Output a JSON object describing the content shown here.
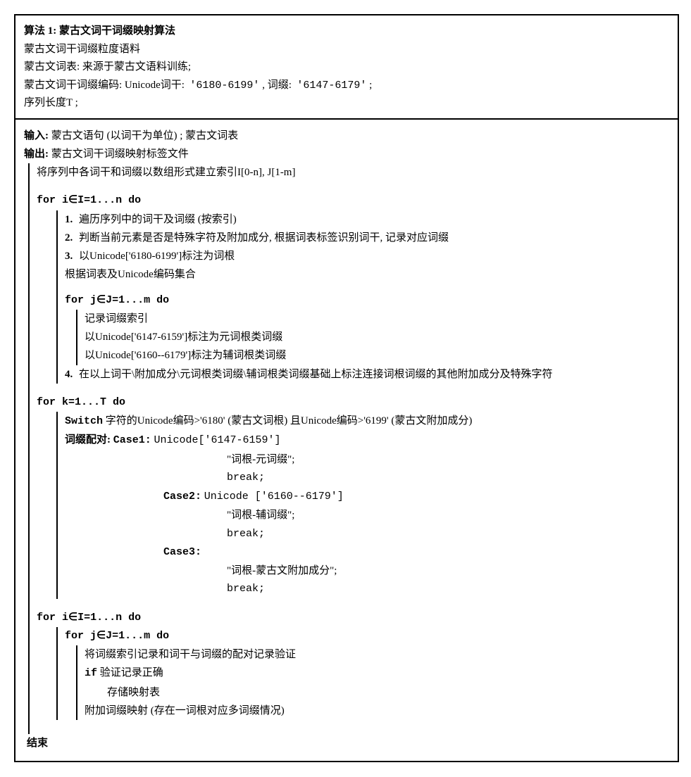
{
  "header": {
    "title_label": "算法 1:",
    "title_text": "蒙古文词干词缀映射算法",
    "line2": "蒙古文词干词缀粒度语料",
    "line3": "蒙古文词表: 来源于蒙古文语料训练;",
    "line4_prefix": "蒙古文词干词缀编码: Unicode词干:",
    "line4_stem_range": "'6180-6199'",
    "line4_mid": ", 词缀:",
    "line4_suffix_range": "'6147-6179'",
    "line4_end": ";",
    "line5": "序列长度T ;"
  },
  "io": {
    "input_label": "输入:",
    "input_text": "蒙古文语句 (以词干为单位) ; 蒙古文词表",
    "output_label": "输出:",
    "output_text": "蒙古文词干词缀映射标签文件",
    "index_line": "将序列中各词干和词缀以数组形式建立索引I[0-n], J[1-m]"
  },
  "loop1": {
    "for_head": "for i∈I=1...n do",
    "step1": "遍历序列中的词干及词缀 (按索引)",
    "step2": "判断当前元素是否是特殊字符及附加成分, 根据词表标签识别词干, 记录对应词缀",
    "step3": "以Unicode['6180-6199']标注为词根",
    "step3b": "根据词表及Unicode编码集合",
    "inner_for": "for j∈J=1...m do",
    "inner1": "记录词缀索引",
    "inner2": "以Unicode['6147-6159']标注为元词根类词缀",
    "inner3": "以Unicode['6160--6179']标注为辅词根类词缀",
    "step4": "在以上词干\\附加成分\\元词根类词缀\\辅词根类词缀基础上标注连接词根词缀的其他附加成分及特殊字符"
  },
  "loop2": {
    "for_head": "for k=1...T do",
    "switch_label": "Switch",
    "switch_cond": "字符的Unicode编码>'6180' (蒙古文词根) 且Unicode编码>'6199' (蒙古文附加成分)",
    "pair_label": "词缀配对:",
    "case1_label": "Case1:",
    "case1_range": "Unicode['6147-6159']",
    "case1_body": "\"词根-元词缀\";",
    "case2_label": "Case2:",
    "case2_range": "Unicode ['6160--6179']",
    "case2_body": "\"词根-辅词缀\";",
    "case3_label": "Case3:",
    "case3_body": "\"词根-蒙古文附加成分\";",
    "break": "break;"
  },
  "loop3": {
    "for_i": "for i∈I=1...n do",
    "for_j": "for j∈J=1...m do",
    "l1": "将词缀索引记录和词干与词缀的配对记录验证",
    "l2_if": "if",
    "l2_cond": "验证记录正确",
    "l3": "存储映射表",
    "l4": "附加词缀映射 (存在一词根对应多词缀情况)"
  },
  "end": "结束"
}
